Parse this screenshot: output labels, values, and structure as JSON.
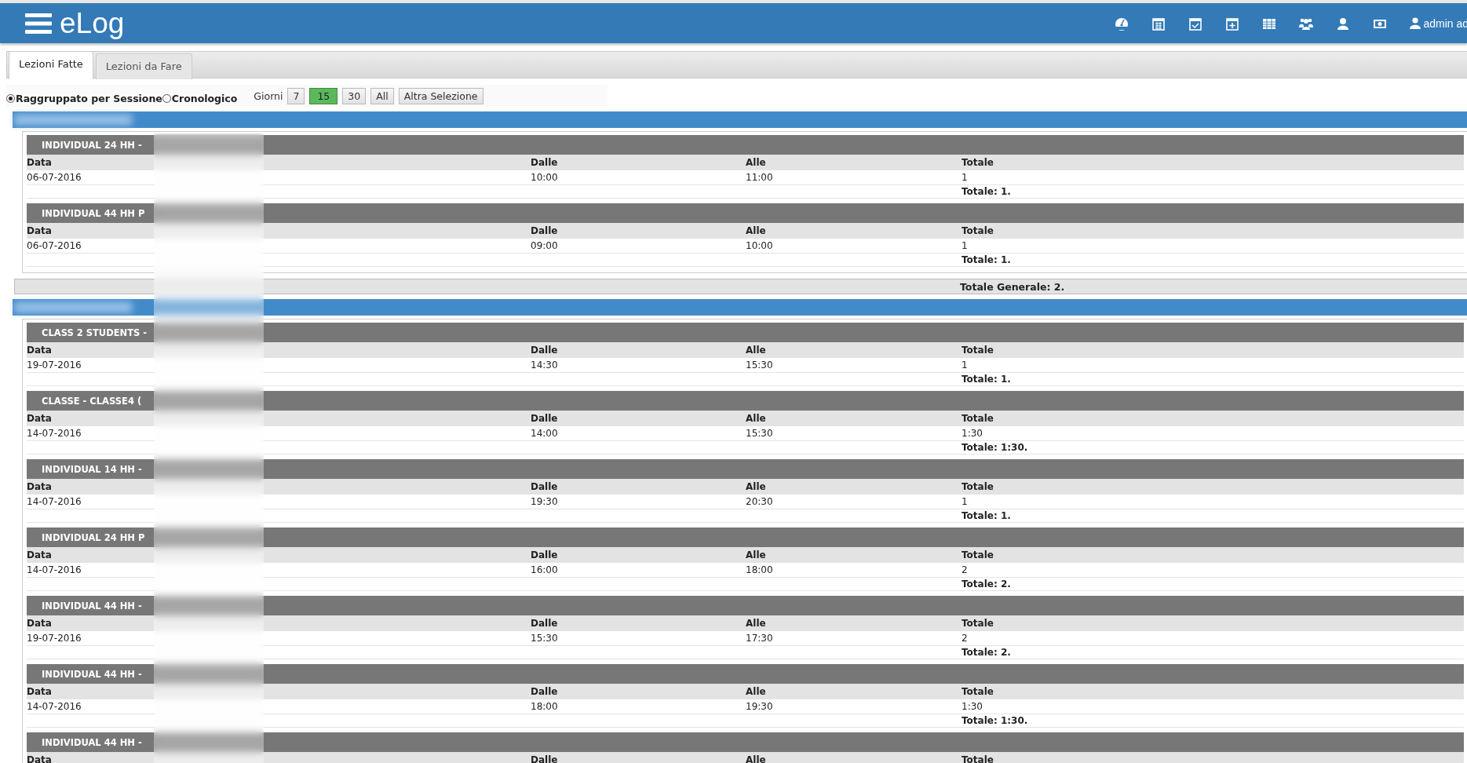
{
  "header": {
    "logo": "eLog",
    "user": "admin ad"
  },
  "tabs": [
    {
      "label": "Lezioni Fatte",
      "selected": true
    },
    {
      "label": "Lezioni da Fare",
      "selected": false
    }
  ],
  "view_options": [
    {
      "label": "Raggruppato per Sessione",
      "selected": true
    },
    {
      "label": "Cronologico",
      "selected": false
    }
  ],
  "days_label": "Giorni",
  "day_buttons": [
    {
      "label": "7",
      "selected": false
    },
    {
      "label": "15",
      "selected": true
    },
    {
      "label": "30",
      "selected": false
    },
    {
      "label": "All",
      "selected": false
    },
    {
      "label": "Altra Selezione",
      "selected": false
    }
  ],
  "groups": [
    {
      "grand_total": "Totale Generale: 2.",
      "sessions": [
        {
          "title": "INDIVIDUAL 24 HH -",
          "columns": [
            "Data",
            "Dalle",
            "Alle",
            "Totale"
          ],
          "rows": [
            [
              "06-07-2016",
              "10:00",
              "11:00",
              "1"
            ]
          ],
          "total": "Totale: 1."
        },
        {
          "title": "INDIVIDUAL 44 HH P",
          "columns": [
            "Data",
            "Dalle",
            "Alle",
            "Totale"
          ],
          "rows": [
            [
              "06-07-2016",
              "09:00",
              "10:00",
              "1"
            ]
          ],
          "total": "Totale: 1."
        }
      ]
    },
    {
      "sessions": [
        {
          "title": "CLASS 2 STUDENTS -",
          "columns": [
            "Data",
            "Dalle",
            "Alle",
            "Totale"
          ],
          "rows": [
            [
              "19-07-2016",
              "14:30",
              "15:30",
              "1"
            ]
          ],
          "total": "Totale: 1."
        },
        {
          "title": "CLASSE - CLASSE4 (",
          "columns": [
            "Data",
            "Dalle",
            "Alle",
            "Totale"
          ],
          "rows": [
            [
              "14-07-2016",
              "14:00",
              "15:30",
              "1:30"
            ]
          ],
          "total": "Totale: 1:30."
        },
        {
          "title": "INDIVIDUAL 14 HH -",
          "columns": [
            "Data",
            "Dalle",
            "Alle",
            "Totale"
          ],
          "rows": [
            [
              "14-07-2016",
              "19:30",
              "20:30",
              "1"
            ]
          ],
          "total": "Totale: 1."
        },
        {
          "title": "INDIVIDUAL 24 HH P",
          "columns": [
            "Data",
            "Dalle",
            "Alle",
            "Totale"
          ],
          "rows": [
            [
              "14-07-2016",
              "16:00",
              "18:00",
              "2"
            ]
          ],
          "total": "Totale: 2."
        },
        {
          "title": "INDIVIDUAL 44 HH -",
          "columns": [
            "Data",
            "Dalle",
            "Alle",
            "Totale"
          ],
          "rows": [
            [
              "19-07-2016",
              "15:30",
              "17:30",
              "2"
            ]
          ],
          "total": "Totale: 2."
        },
        {
          "title": "INDIVIDUAL 44 HH -",
          "columns": [
            "Data",
            "Dalle",
            "Alle",
            "Totale"
          ],
          "rows": [
            [
              "14-07-2016",
              "18:00",
              "19:30",
              "1:30"
            ]
          ],
          "total": "Totale: 1:30."
        },
        {
          "title": "INDIVIDUAL 44 HH -",
          "columns": [
            "Data",
            "Dalle",
            "Alle",
            "Totale"
          ]
        }
      ]
    }
  ]
}
